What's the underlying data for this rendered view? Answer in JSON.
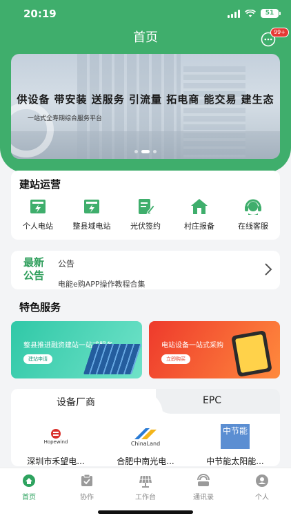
{
  "status": {
    "time": "20:19",
    "battery": "51"
  },
  "header": {
    "title": "首页",
    "msg_badge": "99+"
  },
  "banner": {
    "slogan": "供设备 带安装 送服务 引流量 拓电商 能交易 建生态",
    "subtitle": "一站式全寿期综合服务平台"
  },
  "ops": {
    "title": "建站运营",
    "items": [
      {
        "label": "个人电站",
        "icon": "power-station-icon"
      },
      {
        "label": "整县域电站",
        "icon": "county-station-icon"
      },
      {
        "label": "光伏签约",
        "icon": "contract-sign-icon"
      },
      {
        "label": "村庄报备",
        "icon": "village-house-icon"
      },
      {
        "label": "在线客服",
        "icon": "customer-service-icon"
      }
    ]
  },
  "notice": {
    "logo_top": "最新",
    "logo_bottom": "公告",
    "label": "公告",
    "line2": "电能e购APP操作教程合集"
  },
  "features": {
    "title": "特色服务",
    "left": {
      "text": "整县推进融资建站一站式服务",
      "button": "建站申请"
    },
    "right": {
      "text": "电站设备一站式采购",
      "button": "立即购买"
    }
  },
  "manufacturers": {
    "tabs": [
      "设备厂商",
      "EPC"
    ],
    "items": [
      {
        "name": "深圳市禾望电...",
        "logo_text": "Hopewind"
      },
      {
        "name": "合肥中南光电...",
        "logo_text": "ChinaLand"
      },
      {
        "name": "中节能太阳能...",
        "logo_text": "中节能"
      }
    ]
  },
  "tabbar": {
    "items": [
      {
        "label": "首页",
        "active": true
      },
      {
        "label": "协作",
        "active": false
      },
      {
        "label": "工作台",
        "active": false
      },
      {
        "label": "通讯录",
        "active": false
      },
      {
        "label": "个人",
        "active": false
      }
    ]
  },
  "colors": {
    "brand": "#3fae6c",
    "accent_red": "#e53935"
  }
}
